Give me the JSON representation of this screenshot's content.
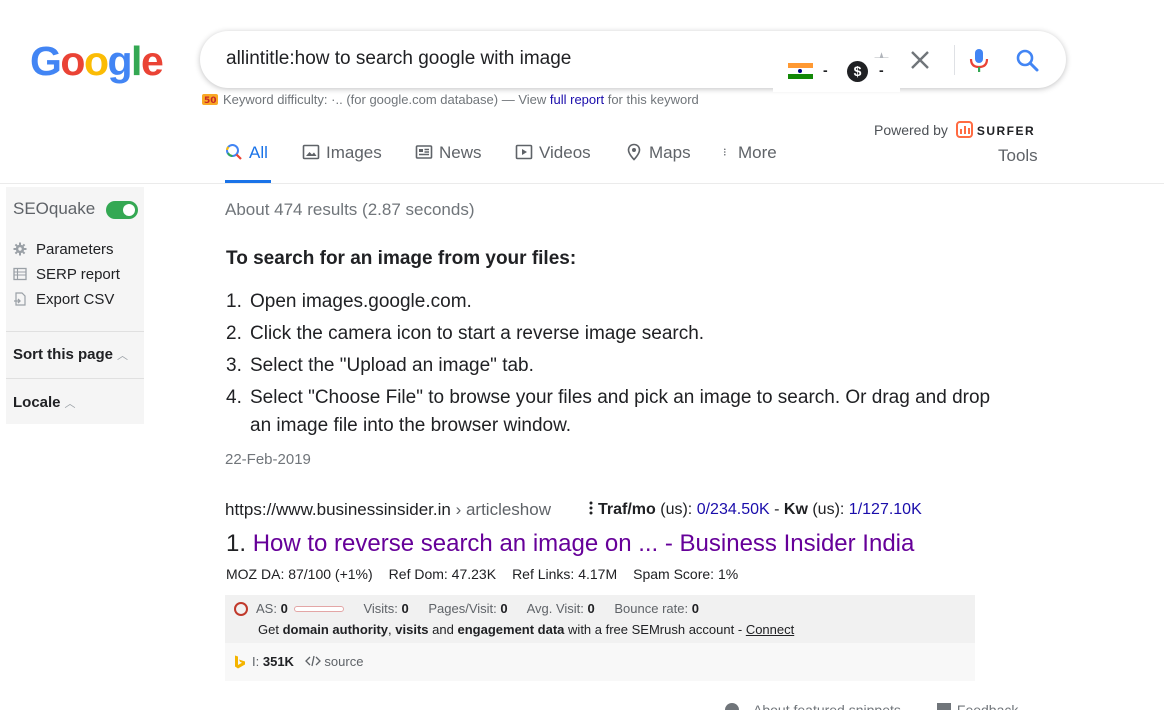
{
  "logo": {
    "letters": [
      "G",
      "o",
      "o",
      "g",
      "l",
      "e"
    ],
    "colors": [
      "#4285f4",
      "#ea4335",
      "#fbbc05",
      "#4285f4",
      "#34a853",
      "#ea4335"
    ]
  },
  "search": {
    "query": "allintitle:how to search google with image"
  },
  "overlay": {
    "dash1": "-",
    "dash2": "-",
    "dollar": "$"
  },
  "keyword_difficulty": {
    "label": "Keyword difficulty:",
    "value": "·..",
    "middle": "(for google.com database) — View",
    "link": "full report",
    "suffix": "for this keyword"
  },
  "powered": {
    "label": "Powered by",
    "brand": "SURFER"
  },
  "tabs": [
    {
      "label": "All",
      "icon": "search-icon"
    },
    {
      "label": "Images",
      "icon": "image-icon"
    },
    {
      "label": "News",
      "icon": "news-icon"
    },
    {
      "label": "Videos",
      "icon": "video-icon"
    },
    {
      "label": "Maps",
      "icon": "map-pin-icon"
    },
    {
      "label": "More",
      "icon": "more-vert-icon"
    }
  ],
  "tools_label": "Tools",
  "seoquake": {
    "title": "SEOquake",
    "items": [
      {
        "label": "Parameters",
        "icon": "gear-icon"
      },
      {
        "label": "SERP report",
        "icon": "table-icon"
      },
      {
        "label": "Export CSV",
        "icon": "export-icon"
      }
    ],
    "sort_label": "Sort this page",
    "locale_label": "Locale"
  },
  "stats": "About 474 results (2.87 seconds)",
  "snippet": {
    "heading": "To search for an image from your files:",
    "steps": [
      {
        "num": "1.",
        "text": "Open images.google.com."
      },
      {
        "num": "2.",
        "text": "Click the camera icon to start a reverse image search."
      },
      {
        "num": "3.",
        "text": "Select the \"Upload an image\" tab."
      },
      {
        "num": "4.",
        "text": "Select \"Choose File\" to browse your files and pick an image to search. Or drag and drop an image file into the browser window."
      }
    ],
    "date": "22-Feb-2019"
  },
  "result": {
    "url": "https://www.businessinsider.in",
    "crumb": "› articleshow",
    "traf_label": "Traf/mo",
    "traf_region": "(us):",
    "traf_value": "0/234.50K",
    "kw_sep": "-",
    "kw_label": "Kw",
    "kw_region": "(us):",
    "kw_value": "1/127.10K",
    "number": "1.",
    "title": "How to reverse search an image on ... - Business Insider India",
    "moz": [
      "MOZ DA: 87/100 (+1%)",
      "Ref Dom: 47.23K",
      "Ref Links: 4.17M",
      "Spam Score: 1%"
    ]
  },
  "semrush": {
    "as_label": "AS:",
    "as_value": "0",
    "visits_label": "Visits:",
    "visits_value": "0",
    "pages_label": "Pages/Visit:",
    "pages_value": "0",
    "avg_label": "Avg. Visit:",
    "avg_value": "0",
    "bounce_label": "Bounce rate:",
    "bounce_value": "0",
    "get": "Get",
    "b1": "domain authority",
    "comma": ",",
    "b2": "visits",
    "and": "and",
    "b3": "engagement data",
    "tail": "with a free SEMrush account -",
    "connect": "Connect"
  },
  "bing": {
    "label": "I:",
    "value": "351K",
    "source": "source"
  },
  "footer": {
    "about": "About featured snippets",
    "feedback": "Feedback"
  }
}
